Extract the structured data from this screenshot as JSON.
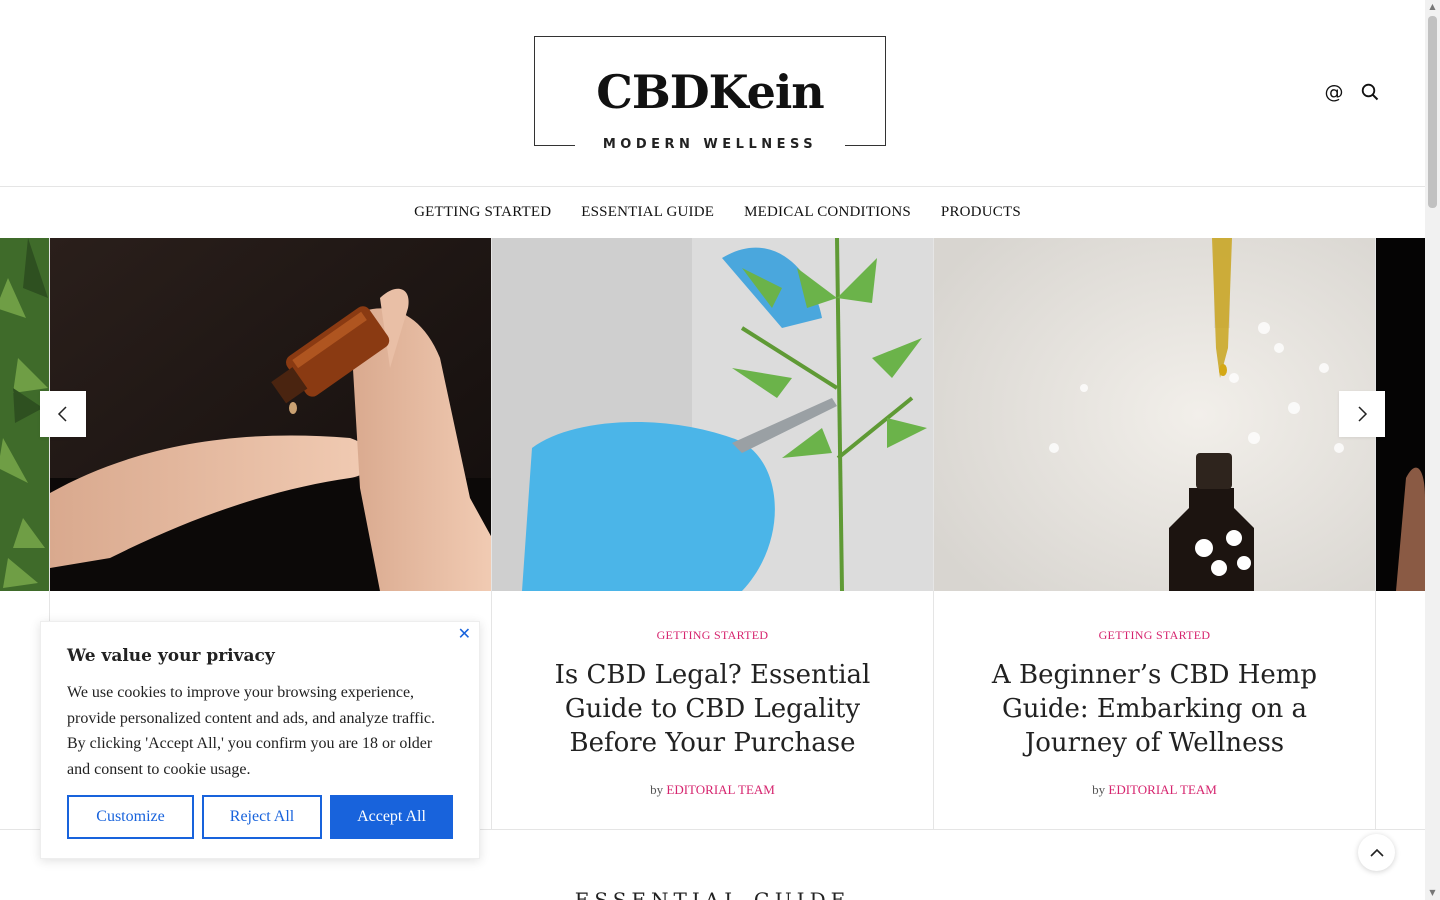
{
  "header": {
    "logo_title": "CBDKein",
    "logo_subtitle": "MODERN WELLNESS",
    "icons": [
      "at-icon",
      "search-icon"
    ],
    "at_glyph": "@"
  },
  "nav": {
    "items": [
      {
        "label": "GETTING STARTED"
      },
      {
        "label": "ESSENTIAL GUIDE"
      },
      {
        "label": "MEDICAL CONDITIONS"
      },
      {
        "label": "PRODUCTS"
      }
    ]
  },
  "slider": {
    "slides": [
      {
        "category": "GETTING STARTED",
        "title": "Is CBD Legal? Essential Guide to CBD Legality Before Your Purchase",
        "by": "by",
        "author": "EDITORIAL TEAM"
      },
      {
        "category": "GETTING STARTED",
        "title": "A Beginner’s CBD Hemp Guide: Embarking on a Journey of Wellness",
        "by": "by",
        "author": "EDITORIAL TEAM"
      }
    ]
  },
  "section": {
    "heading": "ESSENTIAL GUIDE"
  },
  "cookie": {
    "title": "We value your privacy",
    "text": "We use cookies to improve your browsing experience, provide personalized content and ads, and analyze traffic. By clicking 'Accept All,' you confirm you are 18 or older and consent to cookie usage.",
    "customize": "Customize",
    "reject": "Reject All",
    "accept": "Accept All",
    "close_glyph": "✕"
  },
  "colors": {
    "accent": "#d6246e",
    "cookie_blue": "#1863dc"
  }
}
